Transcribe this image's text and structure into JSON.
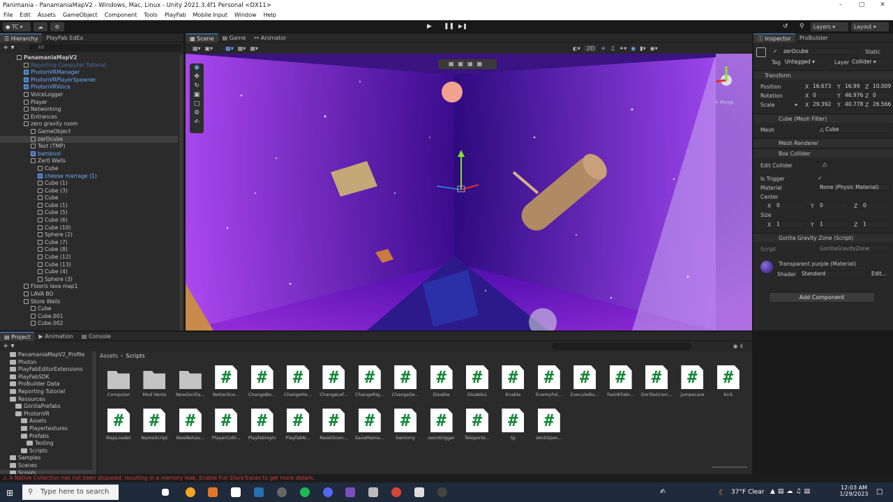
{
  "window": {
    "title": "Panimania - PanamaniaMapV2 - Windows, Mac, Linux - Unity 2021.3.4f1 Personal <DX11>"
  },
  "menu": [
    "File",
    "Edit",
    "Assets",
    "GameObject",
    "Component",
    "Tools",
    "PlayFab",
    "Mobile Input",
    "Window",
    "Help"
  ],
  "toolbar": {
    "account": "TC",
    "layers": "Layers",
    "layout": "Layout"
  },
  "hierarchy": {
    "tabs": [
      "Hierarchy",
      "PlayFab EdEx"
    ],
    "search_placeholder": "All",
    "items": [
      {
        "label": "PanamaniaMapV2",
        "indent": 0,
        "style": "root"
      },
      {
        "label": "Reporting Computer Tutorial",
        "indent": 1,
        "style": "dim"
      },
      {
        "label": "PhotonVRManager",
        "indent": 1,
        "style": "blue"
      },
      {
        "label": "PhotonVRPlayerSpawner",
        "indent": 1,
        "style": "blue"
      },
      {
        "label": "PhotonVRVoice",
        "indent": 1,
        "style": "blue"
      },
      {
        "label": "VoiceLogger",
        "indent": 1,
        "style": ""
      },
      {
        "label": "Player",
        "indent": 1,
        "style": ""
      },
      {
        "label": "Networking",
        "indent": 1,
        "style": ""
      },
      {
        "label": "Entrances",
        "indent": 1,
        "style": ""
      },
      {
        "label": "zero gravity room",
        "indent": 1,
        "style": ""
      },
      {
        "label": "GameObject",
        "indent": 2,
        "style": ""
      },
      {
        "label": "zerOcube",
        "indent": 2,
        "style": "sel"
      },
      {
        "label": "Text (TMP)",
        "indent": 2,
        "style": ""
      },
      {
        "label": "bambool",
        "indent": 2,
        "style": "blue"
      },
      {
        "label": "Zer0 Walls",
        "indent": 2,
        "style": ""
      },
      {
        "label": "Cube",
        "indent": 3,
        "style": ""
      },
      {
        "label": "cheese marrage (1)",
        "indent": 3,
        "style": "blue"
      },
      {
        "label": "Cube (1)",
        "indent": 3,
        "style": ""
      },
      {
        "label": "Cube (3)",
        "indent": 3,
        "style": ""
      },
      {
        "label": "Cube",
        "indent": 3,
        "style": ""
      },
      {
        "label": "Cube (1)",
        "indent": 3,
        "style": ""
      },
      {
        "label": "Cube (5)",
        "indent": 3,
        "style": ""
      },
      {
        "label": "Cube (6)",
        "indent": 3,
        "style": ""
      },
      {
        "label": "Cube (10)",
        "indent": 3,
        "style": ""
      },
      {
        "label": "Sphere (2)",
        "indent": 3,
        "style": ""
      },
      {
        "label": "Cube (7)",
        "indent": 3,
        "style": ""
      },
      {
        "label": "Cube (8)",
        "indent": 3,
        "style": ""
      },
      {
        "label": "Cube (12)",
        "indent": 3,
        "style": ""
      },
      {
        "label": "Cube (13)",
        "indent": 3,
        "style": ""
      },
      {
        "label": "Cube (4)",
        "indent": 3,
        "style": ""
      },
      {
        "label": "Sphere (3)",
        "indent": 3,
        "style": ""
      },
      {
        "label": "Flooris lava map1",
        "indent": 1,
        "style": ""
      },
      {
        "label": "LAVA BO",
        "indent": 1,
        "style": ""
      },
      {
        "label": "Store Walls",
        "indent": 1,
        "style": ""
      },
      {
        "label": "Cube",
        "indent": 2,
        "style": ""
      },
      {
        "label": "Cube.001",
        "indent": 2,
        "style": ""
      },
      {
        "label": "Cube.002",
        "indent": 2,
        "style": ""
      }
    ]
  },
  "scene": {
    "tabs": [
      "Scene",
      "Game",
      "Animator"
    ],
    "mode_2d": "2D",
    "persp": "< Persp"
  },
  "inspector": {
    "tabs": [
      "Inspector",
      "ProBuilder"
    ],
    "object_name": "zerOcube",
    "static_label": "Static",
    "tag_label": "Tag",
    "tag_value": "Untagged",
    "layer_label": "Layer",
    "layer_value": "Collider",
    "transform": {
      "title": "Transform",
      "position": {
        "label": "Position",
        "x": "16.673",
        "y": "16.99",
        "z": "10.009"
      },
      "rotation": {
        "label": "Rotation",
        "x": "0",
        "y": "46.976",
        "z": "0"
      },
      "scale": {
        "label": "Scale",
        "x": "29.392",
        "y": "40.778",
        "z": "26.566"
      }
    },
    "mesh_filter": {
      "title": "Cube (Mesh Filter)",
      "mesh_label": "Mesh",
      "mesh_value": "Cube"
    },
    "mesh_renderer": {
      "title": "Mesh Renderer"
    },
    "box_collider": {
      "title": "Box Collider",
      "edit_label": "Edit Collider",
      "trigger_label": "Is Trigger",
      "material_label": "Material",
      "material_value": "None (Physic Material)",
      "center_label": "Center",
      "center": {
        "x": "0",
        "y": "0",
        "z": "0"
      },
      "size_label": "Size",
      "size": {
        "x": "1",
        "y": "1",
        "z": "1"
      }
    },
    "script_comp": {
      "title": "Gorilla Gravity Zone (Script)",
      "script_label": "Script",
      "script_value": "GorillaGravityZone"
    },
    "material": {
      "title": "Transparent purple (Material)",
      "shader_label": "Shader",
      "shader_value": "Standard",
      "edit_label": "Edit..."
    },
    "add_component": "Add Component"
  },
  "project": {
    "tabs": [
      "Project",
      "Animation",
      "Console"
    ],
    "breadcrumb": [
      "Assets",
      "Scripts"
    ],
    "count": "4",
    "tree": [
      {
        "label": "PanamaniaMapV2_Profile",
        "indent": 1
      },
      {
        "label": "Photon",
        "indent": 1
      },
      {
        "label": "PlayFabEditorExtensions",
        "indent": 1
      },
      {
        "label": "PlayFabSDK",
        "indent": 1
      },
      {
        "label": "ProBuilder Data",
        "indent": 1
      },
      {
        "label": "Reporting Tutorial",
        "indent": 1
      },
      {
        "label": "Resources",
        "indent": 1
      },
      {
        "label": "GorillaPrefabs",
        "indent": 2
      },
      {
        "label": "PhotonVR",
        "indent": 2
      },
      {
        "label": "Assets",
        "indent": 3
      },
      {
        "label": "Playertextures",
        "indent": 3
      },
      {
        "label": "Prefabs",
        "indent": 3
      },
      {
        "label": "Testing",
        "indent": 4
      },
      {
        "label": "Scripts",
        "indent": 3
      },
      {
        "label": "Samples",
        "indent": 1
      },
      {
        "label": "Scenes",
        "indent": 1
      },
      {
        "label": "Scripts",
        "indent": 1,
        "sel": true
      }
    ],
    "assets_row1": [
      {
        "name": "Computer",
        "kind": "folder"
      },
      {
        "name": "Mod Vents",
        "kind": "folder"
      },
      {
        "name": "NewGorilla...",
        "kind": "folder"
      },
      {
        "name": "BetterSce...",
        "kind": "script"
      },
      {
        "name": "ChangeBo...",
        "kind": "script"
      },
      {
        "name": "ChangeHe...",
        "kind": "script"
      },
      {
        "name": "ChangeLef...",
        "kind": "script"
      },
      {
        "name": "ChangeRig...",
        "kind": "script"
      },
      {
        "name": "ChangeSe...",
        "kind": "script"
      },
      {
        "name": "Disable",
        "kind": "script"
      },
      {
        "name": "Disable1",
        "kind": "script"
      },
      {
        "name": "Enable",
        "kind": "script"
      },
      {
        "name": "EnemyFol...",
        "kind": "script"
      },
      {
        "name": "ExecuteBu...",
        "kind": "script"
      },
      {
        "name": "FastIKFabr...",
        "kind": "script"
      },
      {
        "name": "GorillaGravi...",
        "kind": "script"
      },
      {
        "name": "Jumpscare",
        "kind": "script"
      },
      {
        "name": "kick",
        "kind": "script"
      }
    ],
    "assets_row2": [
      {
        "name": "MapLoader",
        "kind": "script"
      },
      {
        "name": "NameScript",
        "kind": "script"
      },
      {
        "name": "NewBehav...",
        "kind": "script"
      },
      {
        "name": "PlayerColli...",
        "kind": "script"
      },
      {
        "name": "Playfablogin",
        "kind": "script"
      },
      {
        "name": "PlayfabN...",
        "kind": "script"
      },
      {
        "name": "ResetScen...",
        "kind": "script"
      },
      {
        "name": "SaveMama...",
        "kind": "script"
      },
      {
        "name": "Swimmy",
        "kind": "script"
      },
      {
        "name": "swimtrigger",
        "kind": "script"
      },
      {
        "name": "Teleporte...",
        "kind": "script"
      },
      {
        "name": "tp",
        "kind": "script"
      },
      {
        "name": "VentOpen...",
        "kind": "script"
      }
    ]
  },
  "status": {
    "message": "A Native Collection has not been disposed, resulting in a memory leak. Enable Full StackTraces to get more details."
  },
  "taskbar": {
    "search_placeholder": "Type here to search",
    "weather": "37°F  Clear",
    "time": "12:03 AM",
    "date": "1/29/2023"
  },
  "colors": {
    "accent": "#4d8fd8",
    "prefab_blue": "#6fa8ff",
    "error": "#d23c3c",
    "script_green": "#17883a"
  }
}
